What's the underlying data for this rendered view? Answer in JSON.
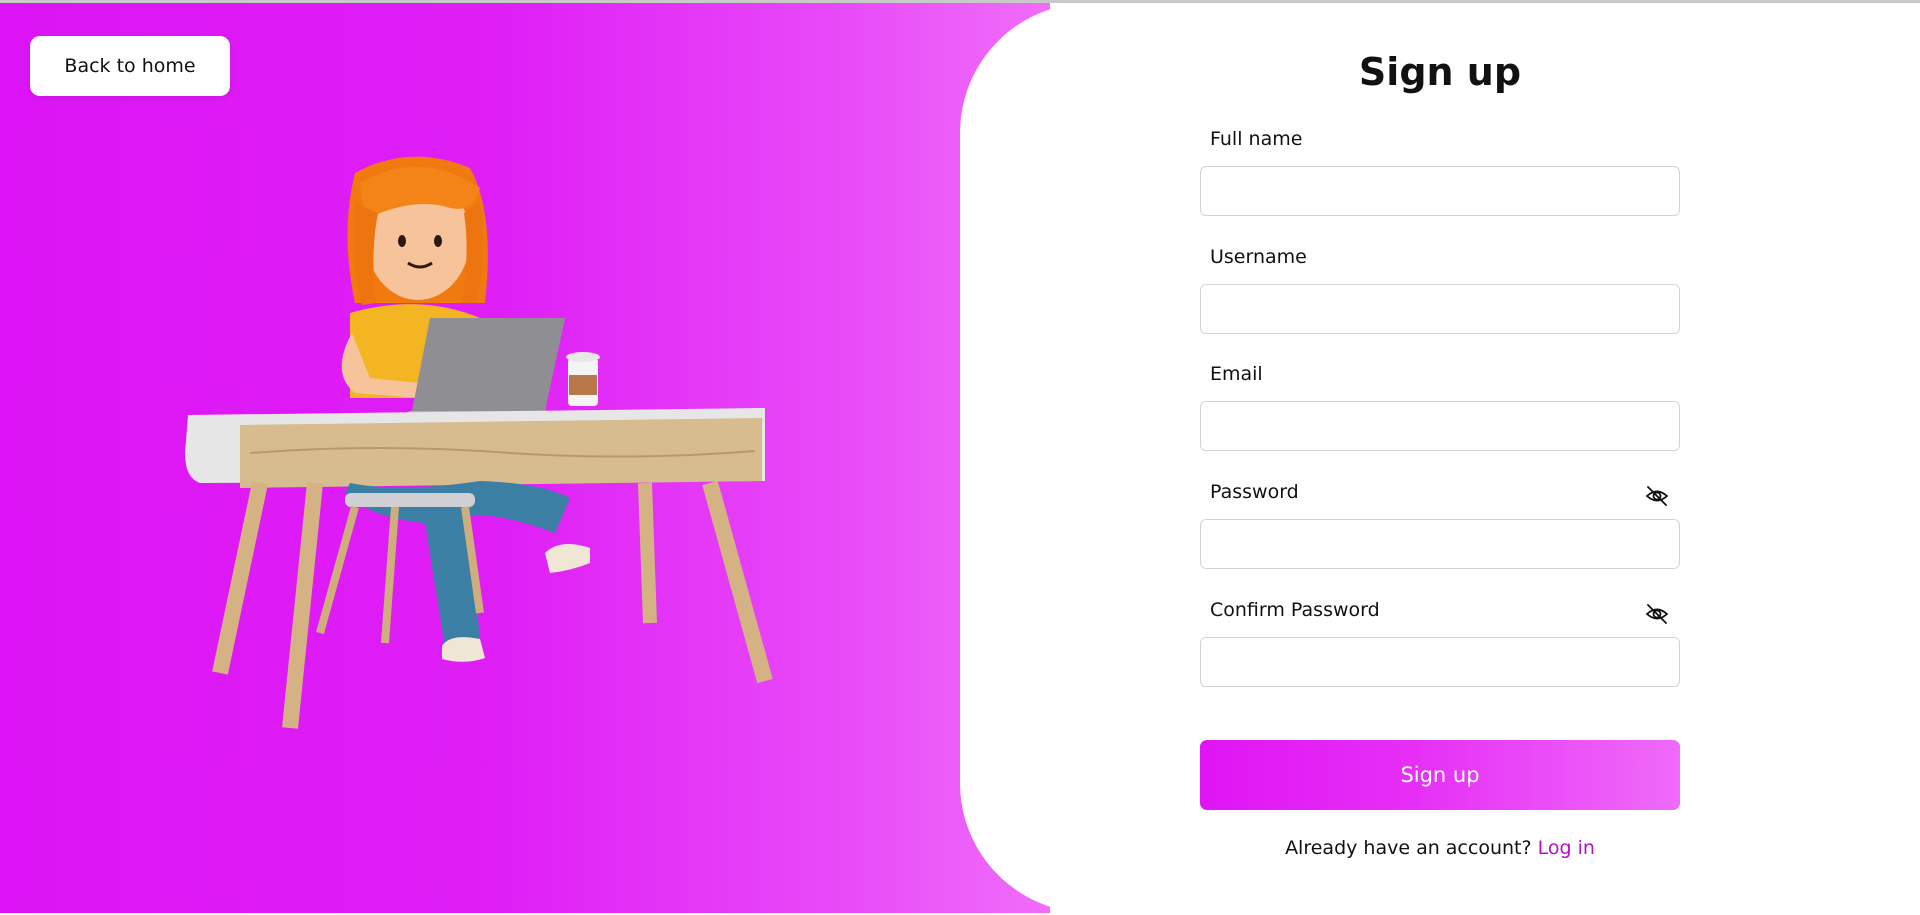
{
  "nav": {
    "back_label": "Back to home"
  },
  "form": {
    "title": "Sign up",
    "fields": [
      {
        "label": "Full name",
        "value": "",
        "placeholder": ""
      },
      {
        "label": "Username",
        "value": "",
        "placeholder": ""
      },
      {
        "label": "Email",
        "value": "",
        "placeholder": ""
      },
      {
        "label": "Password",
        "value": "",
        "placeholder": "",
        "icon": "eye-off-icon"
      },
      {
        "label": "Confirm Password",
        "value": "",
        "placeholder": "",
        "icon": "eye-off-icon"
      }
    ],
    "submit_label": "Sign up",
    "login_prompt": "Already have an account?",
    "login_link": "Log in"
  },
  "colors": {
    "accent": "#dc14f5",
    "accent_light": "#f06df9",
    "link": "#b411c4"
  }
}
